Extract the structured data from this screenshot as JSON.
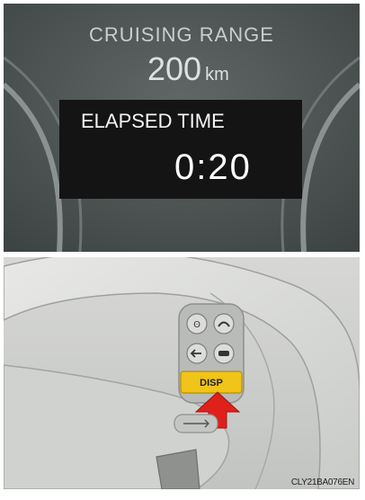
{
  "cluster_display": {
    "range_label": "CRUISING RANGE",
    "range_value": "200",
    "range_unit": "km",
    "elapsed_label": "ELAPSED TIME",
    "elapsed_value": "0:20"
  },
  "steering_controls": {
    "disp_button_label": "DISP",
    "icons": [
      "voice-command-icon",
      "phone-icon",
      "back-icon",
      "hang-up-icon",
      "cruise-control-icon"
    ],
    "highlight_color": "#f0c419",
    "arrow_color": "#e0201b"
  },
  "figure_code": "CLY21BA076EN"
}
